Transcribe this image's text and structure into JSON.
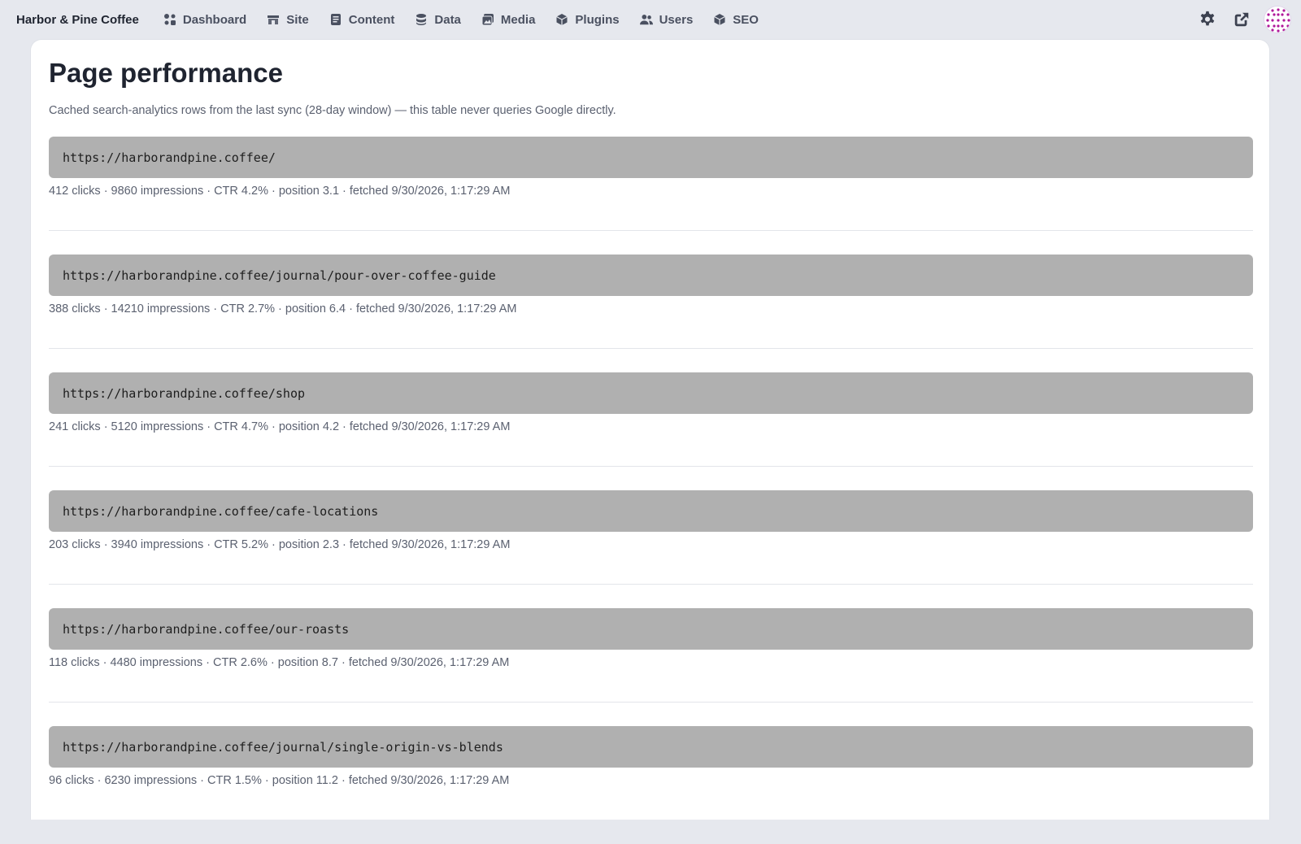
{
  "app": {
    "brand": "Harbor & Pine Coffee"
  },
  "nav": [
    {
      "label": "Dashboard",
      "icon": "dashboard-icon"
    },
    {
      "label": "Site",
      "icon": "site-icon"
    },
    {
      "label": "Content",
      "icon": "content-icon"
    },
    {
      "label": "Data",
      "icon": "data-icon"
    },
    {
      "label": "Media",
      "icon": "media-icon"
    },
    {
      "label": "Plugins",
      "icon": "plugins-icon"
    },
    {
      "label": "Users",
      "icon": "users-icon"
    },
    {
      "label": "SEO",
      "icon": "seo-icon"
    }
  ],
  "toolbar": {
    "icons": [
      "gear-icon",
      "external-link-icon",
      "avatar"
    ]
  },
  "page": {
    "title": "Page performance",
    "subtitle": "Cached search-analytics rows from the last sync (28-day window) — this table never queries Google directly."
  },
  "rows": [
    {
      "url": "https://harborandpine.coffee/",
      "stats": "412 clicks · 9860 impressions · CTR 4.2% · position 3.1 · fetched 9/30/2026, 1:17:29 AM"
    },
    {
      "url": "https://harborandpine.coffee/journal/pour-over-coffee-guide",
      "stats": "388 clicks · 14210 impressions · CTR 2.7% · position 6.4 · fetched 9/30/2026, 1:17:29 AM"
    },
    {
      "url": "https://harborandpine.coffee/shop",
      "stats": "241 clicks · 5120 impressions · CTR 4.7% · position 4.2 · fetched 9/30/2026, 1:17:29 AM"
    },
    {
      "url": "https://harborandpine.coffee/cafe-locations",
      "stats": "203 clicks · 3940 impressions · CTR 5.2% · position 2.3 · fetched 9/30/2026, 1:17:29 AM"
    },
    {
      "url": "https://harborandpine.coffee/our-roasts",
      "stats": "118 clicks · 4480 impressions · CTR 2.6% · position 8.7 · fetched 9/30/2026, 1:17:29 AM"
    },
    {
      "url": "https://harborandpine.coffee/journal/single-origin-vs-blends",
      "stats": "96 clicks · 6230 impressions · CTR 1.5% · position 11.2 · fetched 9/30/2026, 1:17:29 AM"
    }
  ],
  "colors": {
    "background": "#e6e8ee",
    "panel": "#ffffff",
    "url_box": "#b0b0b0",
    "avatar_accent": "#b0189a"
  }
}
